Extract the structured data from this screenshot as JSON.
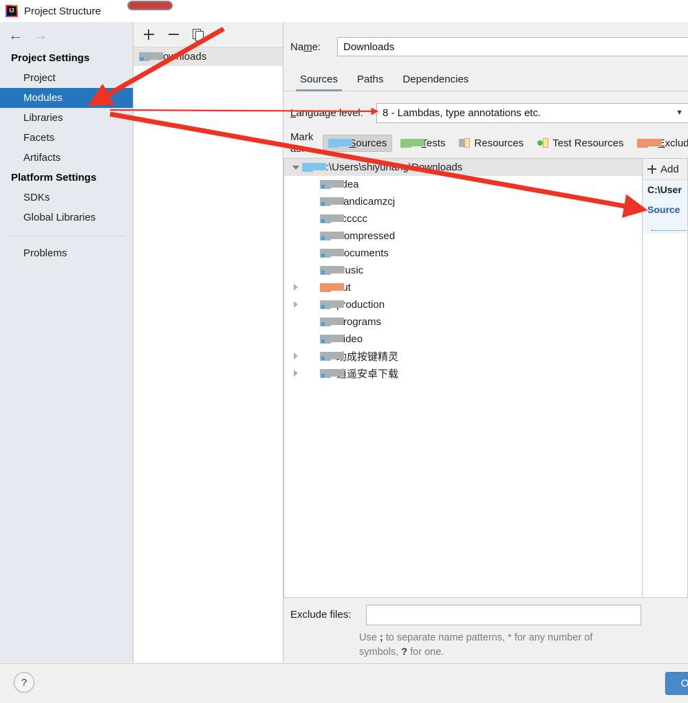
{
  "window": {
    "title": "Project Structure",
    "app_icon": "intellij-idea-icon"
  },
  "nav": {
    "back": "←",
    "forward": "→"
  },
  "sidebar": {
    "groups": [
      {
        "header": "Project Settings",
        "items": [
          {
            "label": "Project",
            "selected": false
          },
          {
            "label": "Modules",
            "selected": true
          },
          {
            "label": "Libraries",
            "selected": false
          },
          {
            "label": "Facets",
            "selected": false
          },
          {
            "label": "Artifacts",
            "selected": false
          }
        ]
      },
      {
        "header": "Platform Settings",
        "items": [
          {
            "label": "SDKs",
            "selected": false
          },
          {
            "label": "Global Libraries",
            "selected": false
          }
        ]
      }
    ],
    "problems": "Problems"
  },
  "modules_panel": {
    "toolbar": [
      {
        "name": "add-module-button",
        "icon": "plus-icon"
      },
      {
        "name": "remove-module-button",
        "icon": "minus-icon"
      },
      {
        "name": "copy-module-button",
        "icon": "copy-icon"
      }
    ],
    "items": [
      {
        "label": "Downloads",
        "selected": true,
        "icon": "module-folder-icon"
      }
    ]
  },
  "main": {
    "name_label": "Name:",
    "name_label_pre": "Na",
    "name_label_mnemonic": "m",
    "name_label_post": "e:",
    "name_value": "Downloads",
    "tabs": [
      {
        "label": "Sources",
        "active": true
      },
      {
        "label": "Paths",
        "active": false
      },
      {
        "label": "Dependencies",
        "active": false
      }
    ],
    "language_level": {
      "label": "Language level:",
      "label_pre": "",
      "label_mnemonic": "L",
      "label_post": "anguage level:",
      "value": "8 - Lambdas, type annotations etc.",
      "caret": "▼"
    },
    "mark_as": {
      "label": "Mark as:",
      "buttons": [
        {
          "label": "Sources",
          "mnemonic": "S",
          "rest": "ources",
          "icon": "sources-folder-icon",
          "hovered": true
        },
        {
          "label": "Tests",
          "mnemonic": "T",
          "rest": "ests",
          "icon": "tests-folder-icon",
          "hovered": false
        },
        {
          "label": "Resources",
          "mnemonic": "R",
          "rest": "esources",
          "icon": "resources-folder-icon",
          "hovered": false
        },
        {
          "label": "Test Resources",
          "mnemonic": "",
          "rest": "Test Resources",
          "icon": "test-resources-folder-icon",
          "hovered": false
        },
        {
          "label": "Excluded",
          "mnemonic": "E",
          "rest": "xcluded",
          "icon": "excluded-folder-icon",
          "hovered": false
        }
      ]
    },
    "tree": {
      "root": {
        "label": "C:\\Users\\shiyuhang\\Downloads",
        "icon": "blue-folder-icon",
        "expanded": true,
        "selected": true
      },
      "children": [
        {
          "label": ".idea",
          "icon": "gray-folder-icon",
          "expandable": false
        },
        {
          "label": "Bandicamzcj",
          "icon": "gray-folder-icon",
          "expandable": false
        },
        {
          "label": "cccccc",
          "icon": "gray-folder-icon",
          "expandable": false
        },
        {
          "label": "Compressed",
          "icon": "gray-folder-icon",
          "expandable": false
        },
        {
          "label": "Documents",
          "icon": "gray-folder-icon",
          "expandable": false
        },
        {
          "label": "Music",
          "icon": "gray-folder-icon",
          "expandable": false
        },
        {
          "label": "out",
          "icon": "orange-folder-icon",
          "expandable": true
        },
        {
          "label": "production",
          "icon": "gray-folder-icon",
          "expandable": true
        },
        {
          "label": "Programs",
          "icon": "gray-folder-icon",
          "expandable": false
        },
        {
          "label": "Video",
          "icon": "gray-folder-icon",
          "expandable": false
        },
        {
          "label": "助成按键精灵",
          "icon": "gray-folder-icon",
          "expandable": true
        },
        {
          "label": "逍遥安卓下载",
          "icon": "gray-folder-icon",
          "expandable": true
        }
      ]
    },
    "right_panel": {
      "add_label": "Add",
      "path_label": "C:\\User",
      "source_label": "Source",
      "entry": "."
    },
    "exclude": {
      "label": "Exclude files:",
      "value": "",
      "hint_1": "Use ",
      "hint_sep": ";",
      "hint_2": " to separate name patterns, * for any number of",
      "hint_3": "symbols, ",
      "hint_q": "?",
      "hint_4": " for one."
    }
  },
  "footer": {
    "help": "?",
    "ok": "O"
  },
  "annotations": {
    "highlight_color": "#cc3b3b",
    "arrow_color": "#ee3224",
    "marks": [
      {
        "name": "title-highlight-oval"
      },
      {
        "name": "arrow-to-modules"
      },
      {
        "name": "arrow-to-language-level"
      },
      {
        "name": "arrow-to-source-panel"
      }
    ]
  }
}
